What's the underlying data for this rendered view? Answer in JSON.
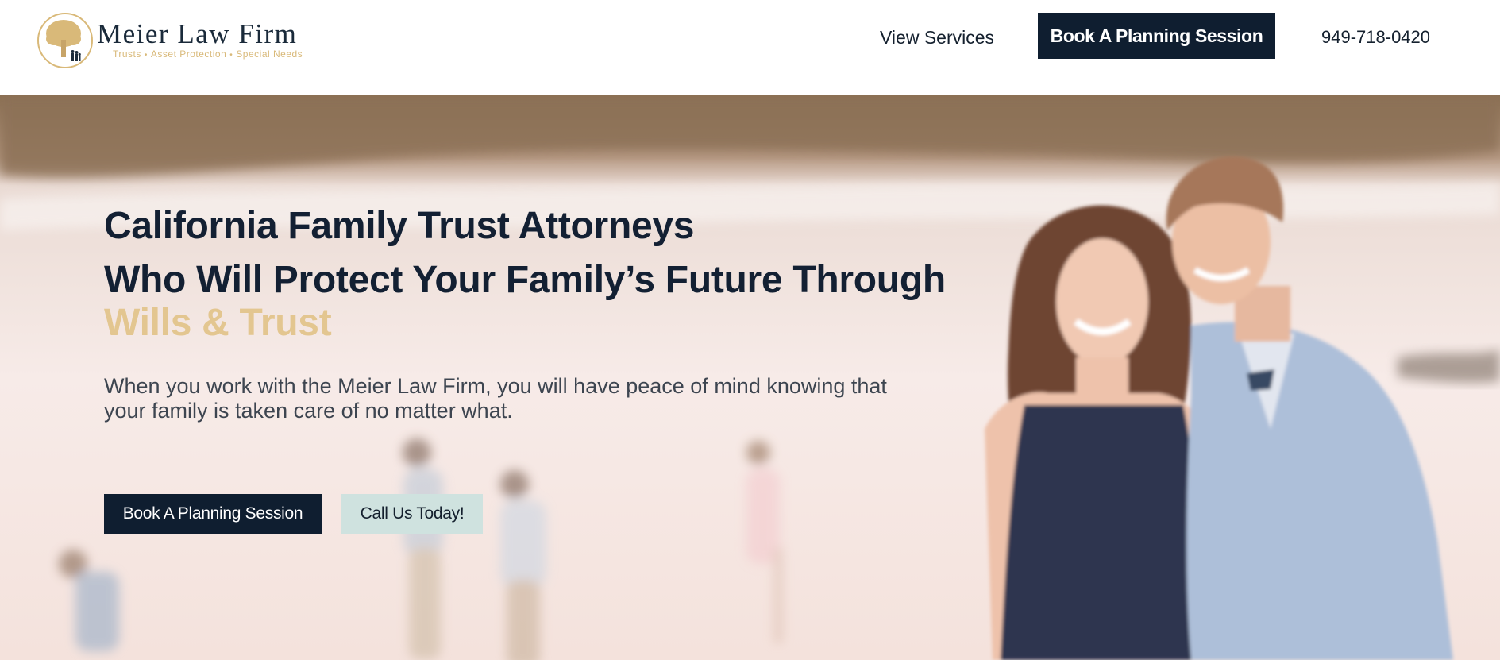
{
  "header": {
    "logo": {
      "name": "Meier Law Firm",
      "tagline_items": [
        "Trusts",
        "Asset Protection",
        "Special Needs"
      ]
    },
    "nav": {
      "services_label": "View Services",
      "book_label": "Book A Planning Session",
      "phone": "949-718-0420"
    }
  },
  "hero": {
    "headline_line1": "California Family Trust Attorneys",
    "headline_line2": "Who Will Protect Your Family’s Future Through",
    "headline_highlight": "Wills & Trust",
    "subcopy": "When you work with the Meier Law Firm, you will have peace of mind knowing that your family is taken care of no matter what.",
    "buttons": {
      "book_label": "Book A Planning Session",
      "call_label": "Call Us Today!"
    }
  },
  "colors": {
    "navy": "#0f1e30",
    "gold": "#e3c690",
    "mint": "#cfe2df",
    "text": "#132033"
  }
}
